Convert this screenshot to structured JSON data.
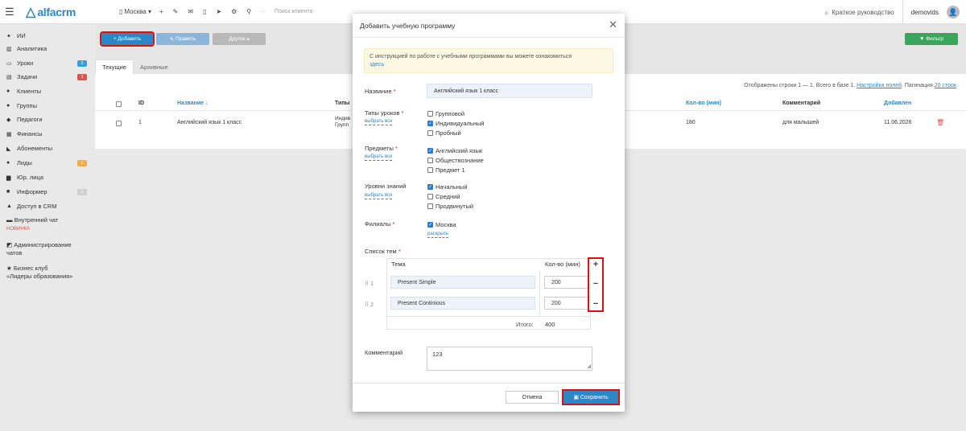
{
  "topbar": {
    "logo_text": "alfacrm",
    "branch": "Москва",
    "search_placeholder": "Поиск клиента",
    "guide": "Краткое руководство",
    "user": "demovids"
  },
  "sidebar": {
    "items": [
      {
        "label": "ИИ",
        "icon": "sparkle-icon"
      },
      {
        "label": "Аналитика",
        "icon": "chart-icon"
      },
      {
        "label": "Уроки",
        "icon": "calendar-icon",
        "badge": "2"
      },
      {
        "label": "Задачи",
        "icon": "tasks-icon",
        "badge": "3"
      },
      {
        "label": "Клиенты",
        "icon": "user-icon"
      },
      {
        "label": "Группы",
        "icon": "group-icon"
      },
      {
        "label": "Педагоги",
        "icon": "teacher-icon"
      },
      {
        "label": "Финансы",
        "icon": "money-icon"
      },
      {
        "label": "Абонементы",
        "icon": "tag-icon"
      },
      {
        "label": "Лиды",
        "icon": "leads-icon",
        "badge": "1"
      },
      {
        "label": "Юр. лица",
        "icon": "briefcase-icon"
      },
      {
        "label": "Информер",
        "icon": "informer-icon",
        "badge": "0"
      },
      {
        "label": "Доступ в CRM",
        "icon": "lock-icon"
      }
    ],
    "chat_label": "Внутренний чат",
    "chat_new": "НОВИНКА",
    "admin_line1": "Администрирование",
    "admin_line2": "чатов",
    "club_line1": "Бизнес клуб",
    "club_line2": "«Лидеры образования»",
    "badge_colors": {
      "blue": "#3a9fd6",
      "red": "#d9534f",
      "orange": "#f0ad4e",
      "gray": "#b9b9b9"
    }
  },
  "toolbar": {
    "add": "+ Добавить",
    "edit": "Править",
    "other": "Другое",
    "filter": "Фильтр"
  },
  "tabs": {
    "current": "Текущие",
    "archive": "Архивные"
  },
  "list": {
    "paging_prefix": "Отображены строки 1 — 1. Всего в базе 1.",
    "paging_settings": "Настройка полей",
    "paging_label": "Пагинация",
    "paging_value": "20 строк",
    "headers": {
      "id": "ID",
      "name": "Название ↓",
      "types": "Типы",
      "duration": "Кол-во (мин)",
      "comment": "Комментарий",
      "added": "Добавлен"
    },
    "row": {
      "id": "1",
      "name": "Английский язык 1 класс",
      "types_line1": "Индив",
      "types_line2": "Групп",
      "duration": "180",
      "comment": "для малышей",
      "added": "11.06.2026"
    }
  },
  "modal": {
    "title": "Добавить учебную программу",
    "info_text": "С инструкцией по работе с учебными программами вы можете ознакомиться",
    "info_link": "здесь",
    "name_label": "Название",
    "name_value": "Английский язык 1 класс",
    "lesson_types_label": "Типы уроков",
    "select_all": "выбрать все",
    "lesson_types": [
      {
        "label": "Групповой",
        "checked": false
      },
      {
        "label": "Индивидуальный",
        "checked": true
      },
      {
        "label": "Пробный",
        "checked": false
      }
    ],
    "subjects_label": "Предметы",
    "subjects": [
      {
        "label": "Английский язык",
        "checked": true
      },
      {
        "label": "Обществознание",
        "checked": false
      },
      {
        "label": "Предмет 1",
        "checked": false
      }
    ],
    "levels_label": "Уровни знаний",
    "levels": [
      {
        "label": "Начальный",
        "checked": true
      },
      {
        "label": "Средний",
        "checked": false
      },
      {
        "label": "Продвинутый",
        "checked": false
      }
    ],
    "branches_label": "Филиалы",
    "branches": [
      {
        "label": "Москва",
        "checked": true
      }
    ],
    "expand": "раскрыть",
    "topics_label": "Список тем",
    "topic_col": "Тема",
    "duration_col": "Кол-во (мин)",
    "topics": [
      {
        "num": "⠿ 1",
        "name": "Present Simple",
        "duration": "200"
      },
      {
        "num": "⠿ 2",
        "name": "Present Continious",
        "duration": "200"
      }
    ],
    "total_label": "Итого:",
    "total_value": "400",
    "comment_label": "Комментарий",
    "comment_value": "123",
    "cancel": "Отмена",
    "save": "Сохранить"
  }
}
